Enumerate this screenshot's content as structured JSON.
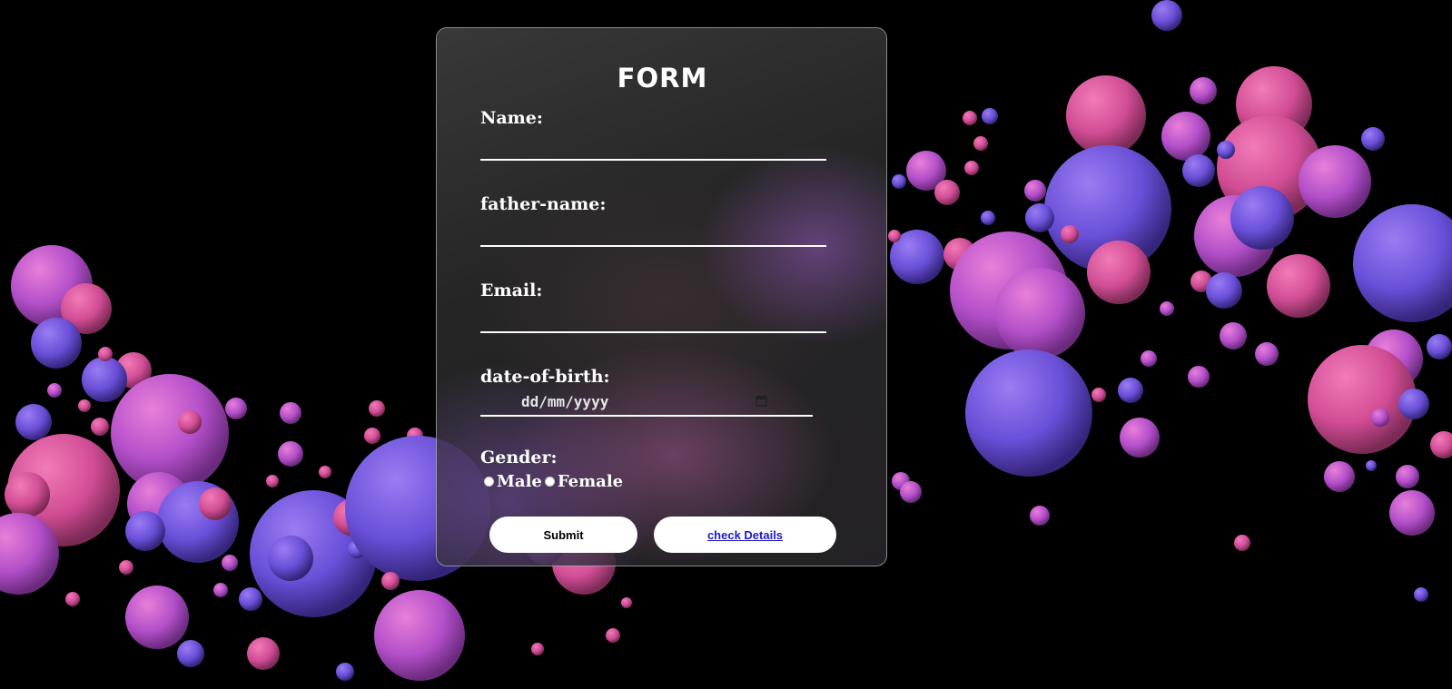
{
  "form": {
    "title": "FORM",
    "fields": {
      "name_label": "Name:",
      "father_name_label": "father-name:",
      "email_label": "Email:",
      "dob_label": "date-of-birth:",
      "dob_placeholder": "dd/mm/yyyy",
      "gender_label": "Gender:"
    },
    "gender_options": [
      "Male",
      "Female"
    ],
    "buttons": {
      "submit": "Submit",
      "check_details": "check Details"
    }
  },
  "colors": {
    "background": "#000000",
    "card": "#3a3a3a",
    "text": "#ffffff",
    "link": "#1a1acc"
  }
}
